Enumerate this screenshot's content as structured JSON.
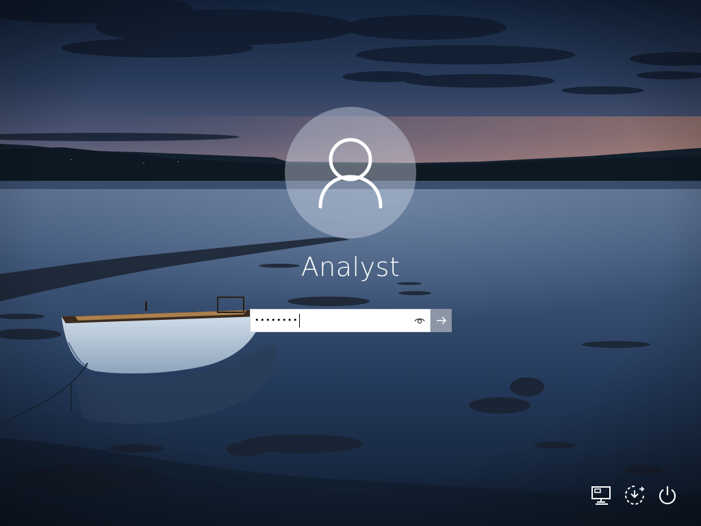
{
  "user": {
    "name": "Analyst"
  },
  "password": {
    "masked_value": "••••••••",
    "reveal_icon": "eye-icon",
    "submit_icon": "arrow-right-icon"
  },
  "corner_icons": {
    "network": "network-icon",
    "ease_of_access": "ease-of-access-icon",
    "power": "power-icon"
  },
  "colors": {
    "avatar_fill": "#d2dae6",
    "submit_bg": "#788496",
    "text": "#ffffff"
  }
}
